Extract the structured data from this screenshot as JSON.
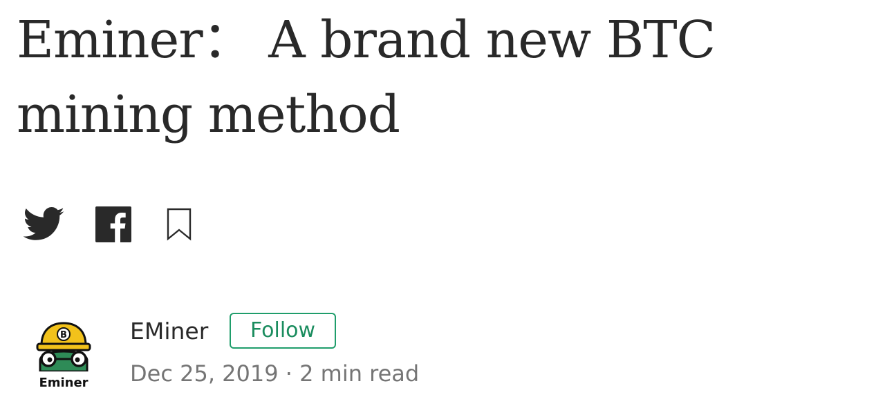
{
  "article": {
    "title": "Eminer： A brand new BTC mining method"
  },
  "share": {
    "icons": [
      "twitter-icon",
      "facebook-icon",
      "bookmark-icon"
    ]
  },
  "author": {
    "name": "EMiner",
    "avatar_label": "Eminer",
    "follow_label": "Follow",
    "date": "Dec 25, 2019",
    "separator": "·",
    "read_time": "2 min read"
  },
  "colors": {
    "text": "#292929",
    "muted": "#757575",
    "accent": "#1a8c5e",
    "helmet": "#f2c21b",
    "mascot_green": "#2e8b57"
  }
}
